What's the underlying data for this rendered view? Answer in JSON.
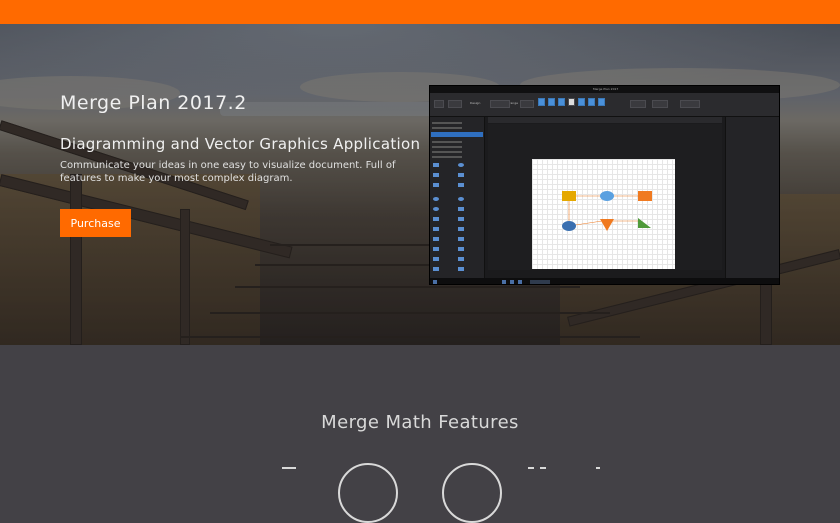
{
  "hero": {
    "title": "Merge Plan 2017.2",
    "subtitle": "Diagramming and Vector Graphics Application",
    "description": "Communicate your ideas in one easy to visualize document. Full of features to make your most complex diagram.",
    "purchase_label": "Purchase"
  },
  "app_screenshot": {
    "window_title": "Merge Plan 2017",
    "tabs": [
      "File",
      "Home",
      "Design",
      "View",
      "Arrange"
    ],
    "diagram_shape_colors": {
      "diamond_shape": "#e5a800",
      "ellipse_top": "#5aa0e0",
      "rectangle_orange": "#f07a20",
      "ellipse_blue": "#3a6fb0",
      "triangle_orange": "#f07a20",
      "triangle_green": "#4f9a3a"
    }
  },
  "features": {
    "title": "Merge Math Features"
  },
  "colors": {
    "accent": "#ff6a00",
    "background": "#434146"
  }
}
